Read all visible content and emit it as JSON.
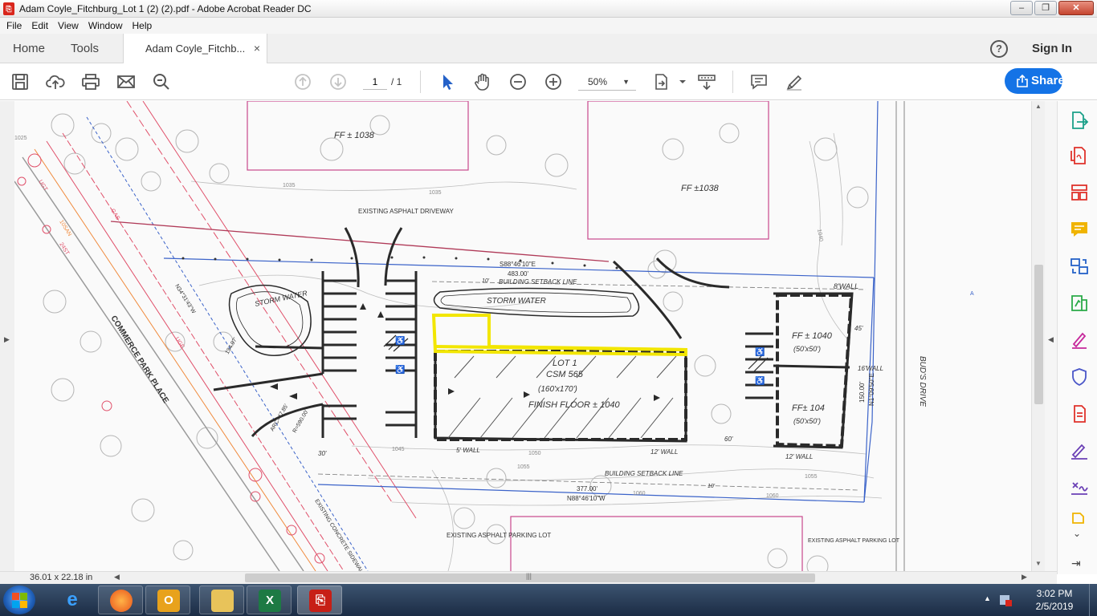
{
  "window": {
    "title": "Adam Coyle_Fitchburg_Lot 1 (2) (2).pdf - Adobe Acrobat Reader DC",
    "app_icon": "acrobat-icon",
    "min_symbol": "▭",
    "max_symbol": "❐",
    "close_symbol": "✕"
  },
  "menu": [
    "File",
    "Edit",
    "View",
    "Window",
    "Help"
  ],
  "tabs": {
    "home": "Home",
    "tools": "Tools",
    "document": "Adam Coyle_Fitchb...",
    "close_symbol": "×",
    "help_symbol": "?",
    "sign_in": "Sign In"
  },
  "toolbar": {
    "current_page": "1",
    "total_pages": "/ 1",
    "zoom": "50%",
    "share_label": "Share",
    "icons": [
      "save-icon",
      "upload-icon",
      "print-icon",
      "email-icon",
      "search-icon",
      "prev-page-icon",
      "next-page-icon",
      "select-cursor-icon",
      "hand-tool-icon",
      "zoom-out-icon",
      "zoom-in-icon",
      "fit-page-icon",
      "read-mode-icon",
      "comment-icon",
      "highlight-pen-icon"
    ]
  },
  "drawing": {
    "texts": {
      "ff1": "FF ± 1038",
      "ff2": "FF ±1038",
      "driveway": "EXISTING ASPHALT DRIVEWAY",
      "bearing_top": "S88°46'10\"E",
      "dist_top": "483.00'",
      "setback_top": "BUILDING SETBACK LINE",
      "storm_water_left": "STORM WATER",
      "storm_water_top": "STORM WATER",
      "wall_top": "8'WALL",
      "lot": "LOT 1",
      "csm": "CSM 565",
      "lot_dims": "(160'x170')",
      "finish_floor": "FINISH FLOOR ± 1040",
      "ff_1040": "FF ± 1040",
      "dims_a": "(50'x50')",
      "ff_104": "FF± 104",
      "dims_b": "(50'x50')",
      "wall_right": "16'WALL",
      "bearing_right": "N1°09'50\"E",
      "dist_right": "150.00'",
      "wall_a": "5' WALL",
      "wall_b": "12' WALL",
      "wall_c": "12' WALL",
      "dim_60": "60'",
      "dim_30": "30'",
      "dim_10": "10'",
      "dim_10b": "10'",
      "dim_45": "45'",
      "setback_bottom": "BUILDING SETBACK LINE",
      "dist_bottom": "377.00'",
      "bearing_bottom": "N88°46'10\"W",
      "street": "COMMERCE PARK PLACE",
      "buds_drive": "BUD'S DRIVE",
      "parking_a": "EXISTING ASPHALT PARKING LOT",
      "parking_b": "EXISTING ASPHALT PARKING LOT",
      "concrete": "EXISTING CONCRETE SIDEWALK",
      "arc": "ARC=47.85'",
      "radius": "R=590.00'",
      "bearing_diag": "N34°31'43\"W",
      "dist_diag": "134.97'",
      "contour_1035": "1035",
      "contour_1035b": "1035",
      "contour_1045": "1045",
      "contour_1050": "1050",
      "contour_1055": "1055",
      "contour_1055b": "1055",
      "contour_1060": "1060",
      "contour_1060b": "1060",
      "contour_1040": "1040",
      "contour_1025": "1025",
      "util_ugt": "UGT",
      "util_gas": "GAS",
      "util_10san": "10SAN",
      "util_24st": "24ST",
      "util_uge": "UGE",
      "marker_a": "A"
    },
    "colors": {
      "ink": "#2a2a2a",
      "property_line": "#3b63c9",
      "building": "#c7488c",
      "utility_red": "#e0506a",
      "utility_orange": "#f08a3c",
      "highlight": "#f2e600",
      "trees": "#9a9a9a"
    }
  },
  "tools_pane": {
    "icons": [
      "export-pdf-icon",
      "create-pdf-icon",
      "organize-pages-icon",
      "comment-tool-icon",
      "combine-files-icon",
      "edit-pdf-icon",
      "fill-sign-icon",
      "protect-icon",
      "compress-icon",
      "send-for-signature-icon",
      "fill-form-icon",
      "more-tools-icon"
    ],
    "collapse_symbol": "⇥",
    "chevron_symbol": "⌄"
  },
  "status": {
    "page_size": "36.01 x 22.18 in"
  },
  "taskbar": {
    "apps": [
      "internet-explorer-icon",
      "firefox-icon",
      "outlook-icon",
      "file-explorer-icon",
      "excel-icon",
      "acrobat-icon"
    ],
    "time": "3:02 PM",
    "date": "2/5/2019"
  }
}
